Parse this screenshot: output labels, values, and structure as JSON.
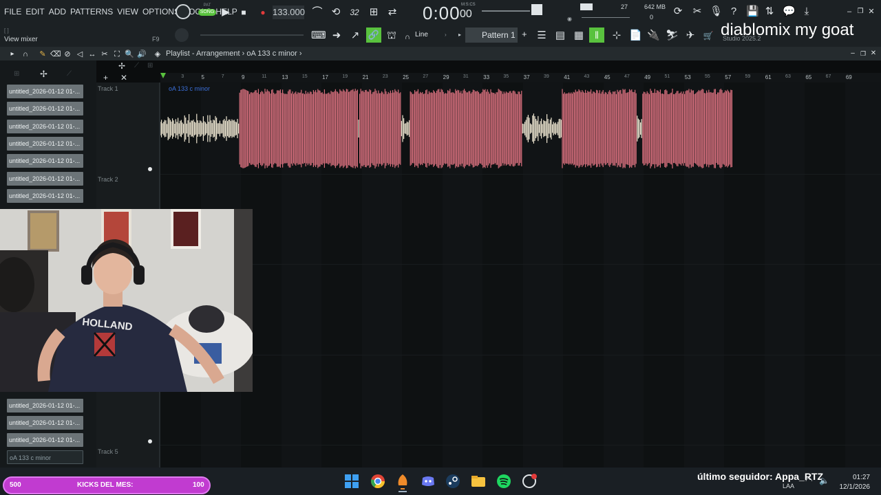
{
  "menu": [
    "FILE",
    "EDIT",
    "ADD",
    "PATTERNS",
    "VIEW",
    "OPTIONS",
    "TOOLS",
    "HELP"
  ],
  "transport": {
    "mode_pat": "PAT",
    "mode_song": "SONG",
    "tempo": "133.000",
    "time_big": "0:00",
    "time_small": "00",
    "time_unit": "M:S:CS",
    "meter_value": "32",
    "cpu_value": "27",
    "memory": "642 MB",
    "memory_zero": "0"
  },
  "toolbar": {
    "snap_label": "Line",
    "pattern_label": "Pattern 1",
    "add_pattern": "+",
    "view_mixer": "View mixer",
    "hint_key": "F9",
    "studio_label": "Studio 2025.2"
  },
  "overlay_text": "diablomix my goat",
  "playlist": {
    "breadcrumb": "Playlist - Arrangement",
    "breadcrumb_sep": "›",
    "current_clip": "oA 133 c minor",
    "clip_label": "oA 133 c minor",
    "ruler_ticks": [
      "3",
      "5",
      "7",
      "9",
      "11",
      "13",
      "15",
      "17",
      "19",
      "21",
      "23",
      "25",
      "27",
      "29",
      "31",
      "33",
      "35",
      "37",
      "39",
      "41",
      "43",
      "45",
      "47",
      "49",
      "51",
      "53",
      "55",
      "57",
      "59",
      "61",
      "63",
      "65",
      "67",
      "69"
    ],
    "tracks": [
      "Track 1",
      "Track 2",
      "Track 5"
    ]
  },
  "clips": [
    "untitled_2026-01-12 01-...",
    "untitled_2026-01-12 01-...",
    "untitled_2026-01-12 01-...",
    "untitled_2026-01-12 01-...",
    "untitled_2026-01-12 01-...",
    "untitled_2026-01-12 01-...",
    "untitled_2026-01-12 01-...",
    "untitled_2026-01-12 01-...",
    "untitled_2026-01-12 01-...",
    "untitled_2026-01-12 01-..."
  ],
  "selected_clip": "oA 133 c minor",
  "stream": {
    "kicks_left": "500",
    "kicks_label": "KICKS DEL MES:",
    "kicks_right": "100",
    "follower": "último seguidor: Appa_RTZ",
    "webcam_shirt": "HOLLAND"
  },
  "system": {
    "time": "01:27",
    "date": "12/1/2026",
    "lang": "LAA"
  },
  "colors": {
    "accent_green": "#59c23e",
    "waveform_pink": "#d9707e",
    "waveform_cream": "#f1e9d4",
    "kick_bar": "#c13bd0",
    "record_red": "#e23b3b"
  }
}
